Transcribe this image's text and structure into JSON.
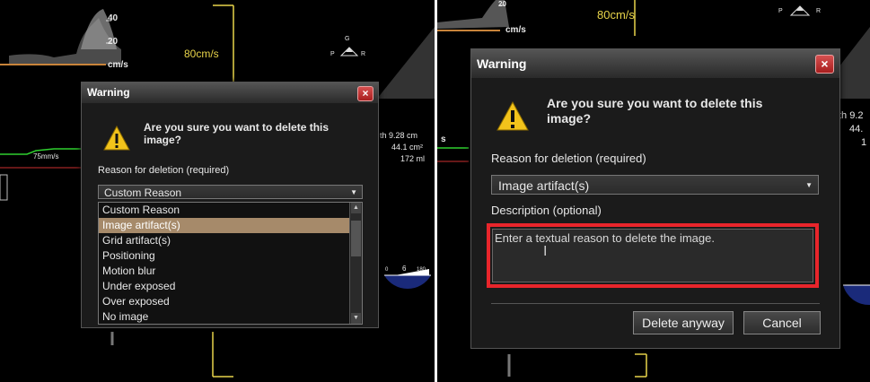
{
  "background": {
    "left": {
      "scale_labels": [
        "40",
        "20",
        "cm/s"
      ],
      "velocity": "80cm/s",
      "sweep": "75mm/s",
      "orientation_letters": [
        "G",
        "P",
        "R"
      ],
      "measurements": [
        "th  9.28 cm",
        "44.1 cm²",
        "172 ml"
      ],
      "gauge_numbers": [
        "0",
        "6",
        "180"
      ]
    },
    "right": {
      "top_scale": "20",
      "unit": "cm/s",
      "velocity": "80cm/s",
      "orientation_letters": [
        "P",
        "R"
      ],
      "measurements": [
        "th  9.2",
        "44.",
        "1"
      ],
      "left_fragment": "s"
    }
  },
  "left_dialog": {
    "title": "Warning",
    "close_label": "×",
    "message": "Are you sure you want to delete this image?",
    "reason_label": "Reason for deletion (required)",
    "selected_value": "Custom Reason",
    "options": [
      "Custom Reason",
      "Image artifact(s)",
      "Grid artifact(s)",
      "Positioning",
      "Motion blur",
      "Under exposed",
      "Over exposed",
      "No image"
    ],
    "highlighted_index": 1
  },
  "right_dialog": {
    "title": "Warning",
    "close_label": "×",
    "message": "Are you sure you want to delete this image?",
    "reason_label": "Reason for deletion (required)",
    "selected_value": "Image artifact(s)",
    "description_label": "Description (optional)",
    "description_placeholder": "Enter a textual reason to delete the image.",
    "highlight_color": "#e8252b",
    "delete_label": "Delete anyway",
    "cancel_label": "Cancel"
  },
  "colors": {
    "accent_yellow": "#e8d44a",
    "dialog_bg": "#1b1b1b",
    "selection": "#a68a6a",
    "close_red": "#c03030"
  }
}
